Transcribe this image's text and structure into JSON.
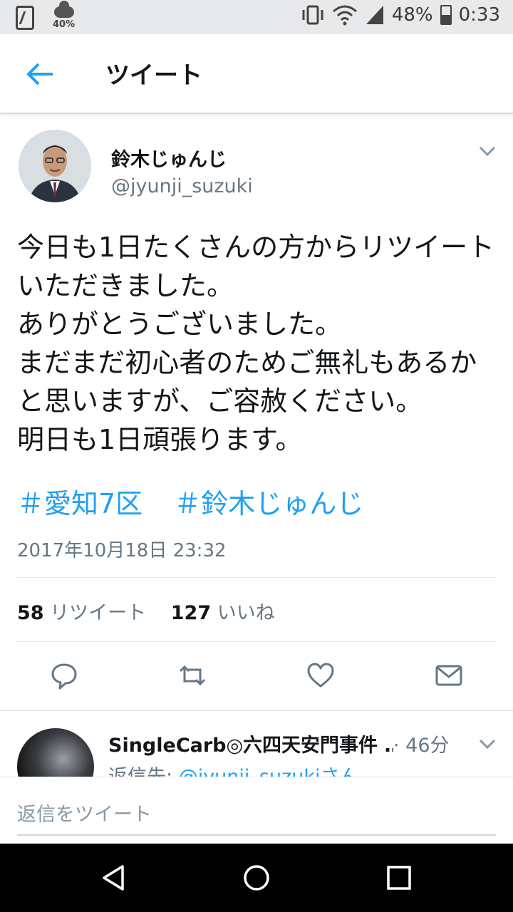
{
  "status_bar": {
    "weather_percent": "40%",
    "battery": "48%",
    "battery_level": 0.48,
    "time": "0:33"
  },
  "app_bar": {
    "title": "ツイート",
    "back_icon": "back-arrow-icon"
  },
  "tweet": {
    "author_name": "鈴木じゅんじ",
    "author_handle": "@jyunji_suzuki",
    "text": "今日も1日たくさんの方からリツイートいただきました。\nありがとうございました。\nまだまだ初心者のためご無礼もあるかと思いますが、ご容赦ください。\n明日も1日頑張ります。",
    "hashtags": [
      "＃愛知7区",
      "＃鈴木じゅんじ"
    ],
    "timestamp": "2017年10月18日 23:32",
    "retweet_count": "58",
    "retweet_label": "リツイート",
    "like_count": "127",
    "like_label": "いいね"
  },
  "actions": [
    "reply-icon",
    "retweet-icon",
    "like-icon",
    "message-icon"
  ],
  "reply": {
    "author_name": "SingleCarb◎六四天安門事件",
    "ellipsis": "…",
    "time": "· 46分",
    "reply_to_prefix": "返信先: ",
    "reply_to_handle": "@jyunji_suzukiさん"
  },
  "composer": {
    "placeholder": "返信をツイート"
  },
  "nav": [
    "back-triangle-icon",
    "home-circle-icon",
    "recents-square-icon"
  ],
  "colors": {
    "accent": "#1da1f2",
    "secondary_text": "#657786",
    "primary_text": "#14171a"
  }
}
